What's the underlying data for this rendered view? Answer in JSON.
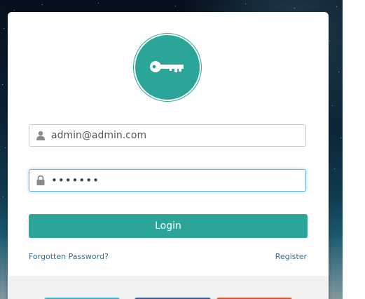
{
  "login": {
    "email_value": "admin@admin.com",
    "password_value": "•••••••",
    "login_label": "Login",
    "forgot_label": "Forgotten Password?",
    "register_label": "Register"
  },
  "icons": {
    "logo": "key-icon",
    "email": "user-icon",
    "password": "lock-icon"
  },
  "colors": {
    "accent": "#2aa597",
    "link": "#2f6f9a",
    "focus_border": "#66afe9",
    "footer_bg": "#f1f1f1",
    "social_1": "#3ab0c8",
    "social_2": "#3b5a98",
    "social_3": "#d3562a"
  }
}
